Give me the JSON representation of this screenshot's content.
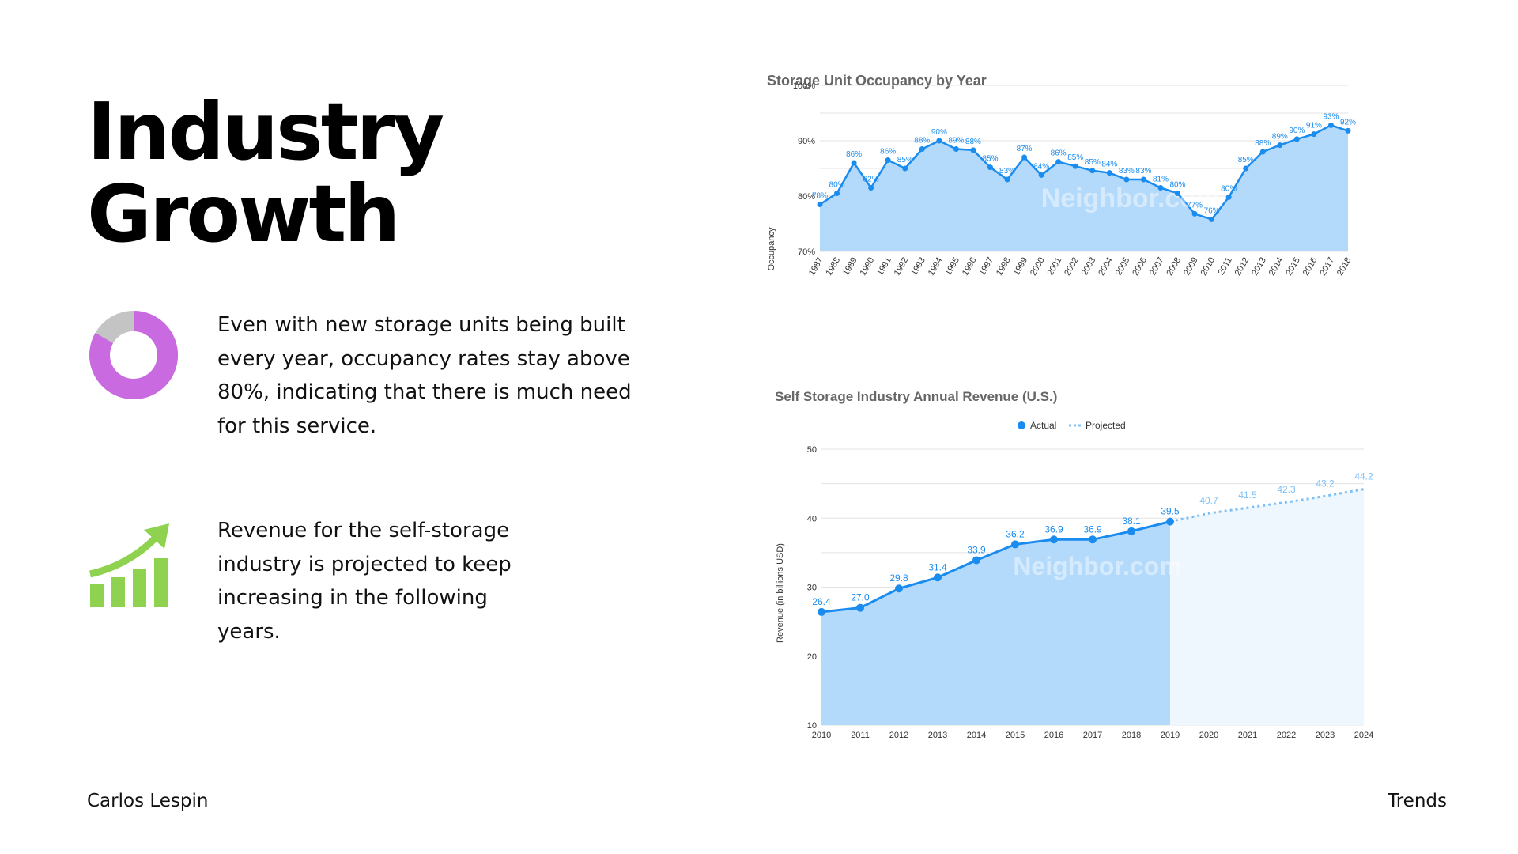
{
  "slide": {
    "title_line1": "Industry",
    "title_line2": "Growth",
    "paragraph1": "Even with new storage units being built every year, occupancy rates stay above 80%, indicating that there is much need for this service.",
    "paragraph2": "Revenue for the self-storage industry is projected to keep increasing in the following years.",
    "footer_left": "Carlos Lespin",
    "footer_right": "Trends"
  },
  "icons": {
    "donut": "donut-chart-icon",
    "growth": "growth-bar-chart-icon",
    "donut_colors": [
      "#c96ae0",
      "#c4c4c4"
    ],
    "growth_color": "#8ed24f"
  },
  "chart_data": [
    {
      "type": "area",
      "title": "Storage Unit Occupancy by Year",
      "xlabel": "",
      "ylabel": "Occupancy",
      "ylim": [
        70,
        100
      ],
      "yticks": [
        "70%",
        "80%",
        "90%",
        "100%"
      ],
      "x": [
        "1987",
        "1988",
        "1989",
        "1990",
        "1991",
        "1992",
        "1993",
        "1994",
        "1995",
        "1996",
        "1997",
        "1998",
        "1999",
        "2000",
        "2001",
        "2002",
        "2003",
        "2004",
        "2005",
        "2006",
        "2007",
        "2008",
        "2009",
        "2010",
        "2011",
        "2012",
        "2013",
        "2014",
        "2015",
        "2016",
        "2017",
        "2018"
      ],
      "values": [
        78.5,
        80.5,
        86,
        81.5,
        86.5,
        85,
        88.5,
        90,
        88.5,
        88.3,
        85.2,
        83,
        87,
        83.8,
        86.2,
        85.4,
        84.6,
        84.2,
        83,
        83,
        81.5,
        80.5,
        76.8,
        75.8,
        79.8,
        85,
        88,
        89.2,
        90.3,
        91.2,
        92.8,
        91.8
      ],
      "data_labels": [
        "78%",
        "80%",
        "86%",
        "82%",
        "86%",
        "85%",
        "88%",
        "90%",
        "89%",
        "88%",
        "85%",
        "83%",
        "87%",
        "84%",
        "86%",
        "85%",
        "85%",
        "84%",
        "83%",
        "83%",
        "81%",
        "80%",
        "77%",
        "76%",
        "80%",
        "85%",
        "88%",
        "89%",
        "90%",
        "91%",
        "93%",
        "92%"
      ],
      "grid": true,
      "watermark": "Neighbor.com",
      "colors": {
        "line": "#1a8cf0",
        "fill": "#b3d9fb",
        "label": "#1a8cf0"
      }
    },
    {
      "type": "area",
      "title": "Self Storage Industry Annual Revenue (U.S.)",
      "xlabel": "",
      "ylabel": "Revenue (in billions USD)",
      "ylim": [
        10,
        50
      ],
      "yticks": [
        "10",
        "20",
        "30",
        "40",
        "50"
      ],
      "x": [
        "2010",
        "2011",
        "2012",
        "2013",
        "2014",
        "2015",
        "2016",
        "2017",
        "2018",
        "2019",
        "2020",
        "2021",
        "2022",
        "2023",
        "2024"
      ],
      "series": [
        {
          "name": "Actual",
          "x": [
            "2010",
            "2011",
            "2012",
            "2013",
            "2014",
            "2015",
            "2016",
            "2017",
            "2018",
            "2019"
          ],
          "values": [
            26.4,
            27.0,
            29.8,
            31.4,
            33.9,
            36.2,
            36.9,
            36.9,
            38.1,
            39.5
          ],
          "labels": [
            "26.4",
            "27.0",
            "29.8",
            "31.4",
            "33.9",
            "36.2",
            "36.9",
            "36.9",
            "38.1",
            "39.5"
          ]
        },
        {
          "name": "Projected",
          "x": [
            "2019",
            "2020",
            "2021",
            "2022",
            "2023",
            "2024"
          ],
          "values": [
            39.5,
            40.7,
            41.5,
            42.3,
            43.2,
            44.2
          ],
          "labels": [
            "",
            "40.7",
            "41.5",
            "42.3",
            "43.2",
            "44.2"
          ]
        }
      ],
      "legend": "top-center",
      "grid": true,
      "watermark": "Neighbor.com",
      "colors": {
        "actual": "#1a8cf0",
        "actual_fill": "#b3d9fb",
        "projected": "#7ec0f5",
        "projected_fill": "#eef6fe"
      }
    }
  ]
}
